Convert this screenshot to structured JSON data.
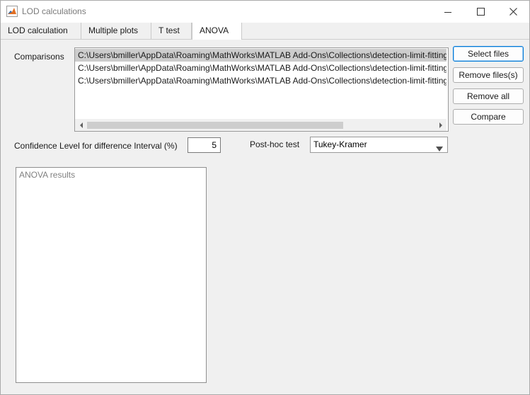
{
  "window": {
    "title": "LOD calculations",
    "icon": "matlab-icon",
    "controls": [
      "minimize-icon",
      "maximize-icon",
      "close-icon"
    ]
  },
  "tabs": [
    {
      "label": "LOD calculation",
      "active": false
    },
    {
      "label": "Multiple plots",
      "active": false
    },
    {
      "label": "T test",
      "active": false
    },
    {
      "label": "ANOVA",
      "active": true
    }
  ],
  "anova": {
    "comparisons_label": "Comparisons",
    "files": [
      {
        "path": "C:\\Users\\bmiller\\AppData\\Roaming\\MathWorks\\MATLAB Add-Ons\\Collections\\detection-limit-fitting",
        "selected": true
      },
      {
        "path": "C:\\Users\\bmiller\\AppData\\Roaming\\MathWorks\\MATLAB Add-Ons\\Collections\\detection-limit-fitting",
        "selected": false
      },
      {
        "path": "C:\\Users\\bmiller\\AppData\\Roaming\\MathWorks\\MATLAB Add-Ons\\Collections\\detection-limit-fitting",
        "selected": false
      }
    ],
    "buttons": {
      "select_files": "Select files",
      "remove_files": "Remove files(s)",
      "remove_all": "Remove all",
      "compare": "Compare"
    },
    "confidence_label": "Confidence Level for difference Interval (%)",
    "confidence_value": "5",
    "posthoc_label": "Post-hoc test",
    "posthoc_selected": "Tukey-Kramer",
    "results_placeholder": "ANOVA results"
  },
  "colors": {
    "accent": "#0078d7",
    "selection": "#cccccc",
    "panel": "#f0f0f0"
  }
}
